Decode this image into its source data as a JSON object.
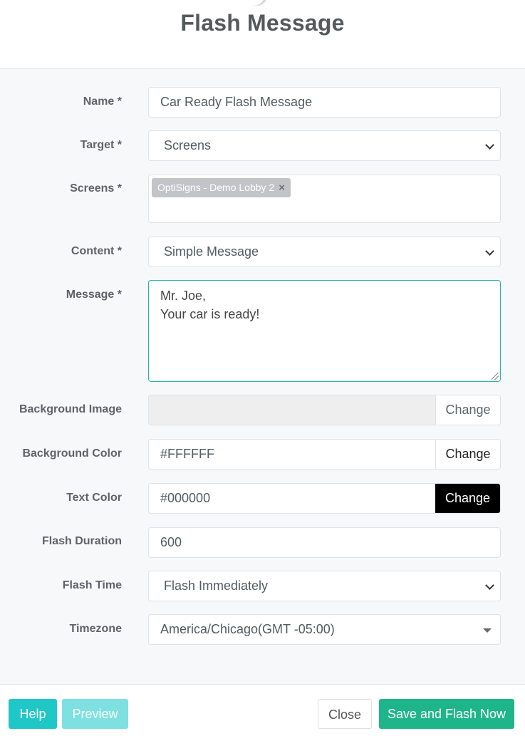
{
  "header": {
    "title": "Flash Message"
  },
  "form": {
    "name": {
      "label": "Name *",
      "value": "Car Ready Flash Message"
    },
    "target": {
      "label": "Target *",
      "value": "Screens"
    },
    "screens": {
      "label": "Screens *",
      "tags": [
        "OptiSigns - Demo Lobby 2"
      ],
      "remove_glyph": "×"
    },
    "content": {
      "label": "Content *",
      "value": "Simple Message"
    },
    "message": {
      "label": "Message *",
      "lines": [
        "Mr. Joe,",
        "Your car is ready!"
      ]
    },
    "background_image": {
      "label": "Background Image",
      "value": "",
      "button": "Change"
    },
    "background_color": {
      "label": "Background Color",
      "value": "#FFFFFF",
      "button": "Change"
    },
    "text_color": {
      "label": "Text Color",
      "value": "#000000",
      "button": "Change"
    },
    "flash_duration": {
      "label": "Flash Duration",
      "value": "600"
    },
    "flash_time": {
      "label": "Flash Time",
      "value": "Flash Immediately"
    },
    "timezone": {
      "label": "Timezone",
      "value": "America/Chicago(GMT -05:00)"
    }
  },
  "footer": {
    "help": "Help",
    "preview": "Preview",
    "close": "Close",
    "save": "Save and Flash Now"
  },
  "colors": {
    "accent_teal": "#1fc8c7",
    "accent_green": "#1fb58a",
    "focus_border": "#26b8a0"
  }
}
